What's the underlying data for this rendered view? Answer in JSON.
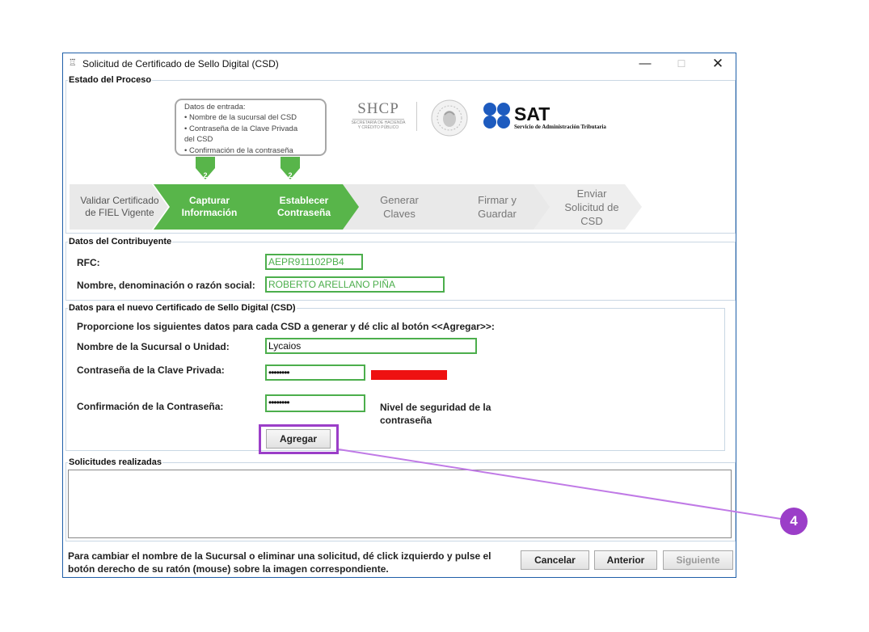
{
  "window": {
    "title": "Solicitud de Certificado de Sello Digital (CSD)",
    "controls": {
      "minimize": "—",
      "maximize": "☐",
      "close": "✕"
    }
  },
  "proceso": {
    "legend": "Estado del Proceso",
    "callout_lines": [
      "Datos de entrada:",
      "• Nombre de la sucursal del CSD",
      "• Contraseña de la Clave Privada",
      "del CSD",
      "• Confirmación de la contraseña"
    ],
    "step_badges": [
      "2",
      "2"
    ],
    "steps": [
      {
        "label": "Validar Certificado de FIEL Vigente",
        "active": false
      },
      {
        "label": "Capturar Información",
        "active": true
      },
      {
        "label": "Establecer Contraseña",
        "active": true
      },
      {
        "label": "Generar Claves",
        "active": false
      },
      {
        "label": "Firmar y Guardar",
        "active": false
      },
      {
        "label": "Enviar Solicitud de CSD",
        "active": false
      }
    ],
    "logos": {
      "shcp": "SHCP",
      "shcp_sub1": "SECRETARÍA DE HACIENDA",
      "shcp_sub2": "Y CRÉDITO PÚBLICO",
      "sat": "SAT",
      "sat_sub": "Servicio de Administración Tributaria"
    }
  },
  "contribuyente": {
    "legend": "Datos del Contribuyente",
    "rfc_label": "RFC:",
    "rfc_value": "AEPR911102PB4",
    "nombre_label": "Nombre, denominación o razón social:",
    "nombre_value": "ROBERTO ARELLANO PIÑA"
  },
  "csd": {
    "legend": "Datos para el nuevo Certificado de Sello Digital (CSD)",
    "instruccion": "Proporcione los siguientes datos para cada CSD a generar y dé clic al botón <<Agregar>>:",
    "sucursal_label": "Nombre de la Sucursal o Unidad:",
    "sucursal_value": "Lycaios",
    "clave_label": "Contraseña de la Clave Privada:",
    "clave_value": "••••••••",
    "confirm_label": "Confirmación de la Contraseña:",
    "confirm_value": "••••••••",
    "nivel_label": "Nivel de seguridad de la contraseña",
    "strength_color": "#ee1111",
    "agregar": "Agregar"
  },
  "solicitudes": {
    "legend": "Solicitudes realizadas"
  },
  "footer": {
    "nota": "Para cambiar el nombre de la Sucursal o eliminar una solicitud, dé click izquierdo y pulse el botón derecho de su ratón (mouse) sobre la imagen correspondiente.",
    "cancelar": "Cancelar",
    "anterior": "Anterior",
    "siguiente": "Siguiente"
  },
  "annotation": {
    "number": "4",
    "color": "#9b3ec8"
  },
  "colors": {
    "active_step": "#58b54a",
    "inactive_step": "#e9e9e9",
    "field_border": "#4cae4c",
    "window_border": "#1f5fa8"
  }
}
